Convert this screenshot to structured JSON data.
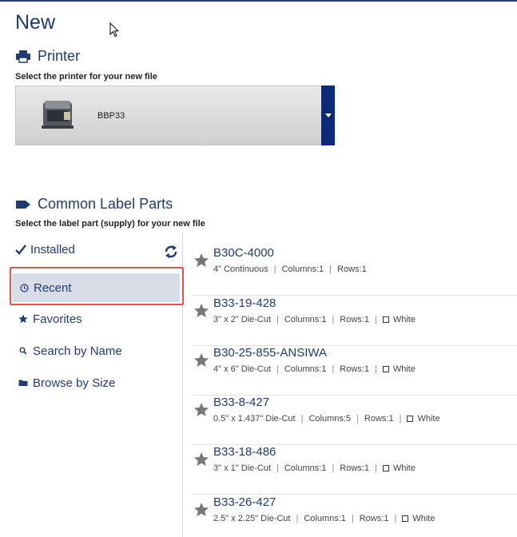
{
  "page_title": "New",
  "printer": {
    "heading": "Printer",
    "subheading": "Select the printer for your new file",
    "selected": "BBP33"
  },
  "label_parts": {
    "heading": "Common Label Parts",
    "subheading": "Select the label part (supply) for your new file"
  },
  "nav": {
    "items": [
      {
        "label": "Installed",
        "icon": "checkmark-icon"
      },
      {
        "label": "Recent",
        "icon": "clock-icon",
        "selected": true
      },
      {
        "label": "Favorites",
        "icon": "star-icon"
      },
      {
        "label": "Search by Name",
        "icon": "search-icon"
      },
      {
        "label": "Browse by Size",
        "icon": "folder-icon"
      }
    ]
  },
  "parts": [
    {
      "name": "B30C-4000",
      "size": "4\" Continuous",
      "columns": "Columns:1",
      "rows": "Rows:1",
      "color": ""
    },
    {
      "name": "B33-19-428",
      "size": "3\" x 2\" Die-Cut",
      "columns": "Columns:1",
      "rows": "Rows:1",
      "color": "White"
    },
    {
      "name": "B30-25-855-ANSIWA",
      "size": "4\" x 6\" Die-Cut",
      "columns": "Columns:1",
      "rows": "Rows:1",
      "color": "White"
    },
    {
      "name": "B33-8-427",
      "size": "0.5\" x 1.437\" Die-Cut",
      "columns": "Columns:5",
      "rows": "Rows:1",
      "color": "White"
    },
    {
      "name": "B33-18-486",
      "size": "3\" x 1\" Die-Cut",
      "columns": "Columns:1",
      "rows": "Rows:1",
      "color": "White"
    },
    {
      "name": "B33-26-427",
      "size": "2.5\" x 2.25\" Die-Cut",
      "columns": "Columns:1",
      "rows": "Rows:1",
      "color": "White"
    }
  ],
  "colors": {
    "accent": "#1f3b73",
    "dropdown": "#0c2a78",
    "highlight": "#e4534a",
    "selected_bg": "#d8dde8"
  }
}
